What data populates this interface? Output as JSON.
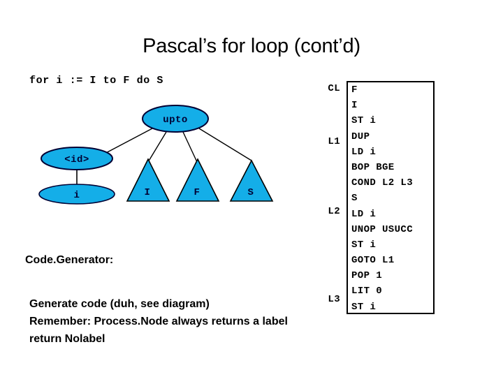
{
  "slide": {
    "title": "Pascal’s for loop (cont’d)",
    "source_line": "for i := I to F do S"
  },
  "colors": {
    "node_fill": "#14AEE8",
    "node_stroke": "#000033",
    "edge_stroke": "#000000",
    "text": "#000000",
    "background": "#FFFFFF"
  },
  "tree": {
    "root": {
      "label": "upto",
      "shape": "ellipse"
    },
    "id_node": {
      "label": "<id>",
      "shape": "ellipse"
    },
    "i_node": {
      "label": "i",
      "shape": "ellipse"
    },
    "subtrees": [
      {
        "label": "I",
        "shape": "triangle"
      },
      {
        "label": "F",
        "shape": "triangle"
      },
      {
        "label": "S",
        "shape": "triangle"
      }
    ]
  },
  "code": {
    "labels": [
      "CL",
      "",
      "",
      "L1",
      "",
      "",
      "",
      "L2",
      "",
      "",
      "",
      "",
      "L3",
      "",
      ""
    ],
    "lines": [
      "F",
      "I",
      "ST i",
      "DUP",
      "LD i",
      "BOP BGE",
      "COND L2 L3",
      "S",
      "LD i",
      "UNOP USUCC",
      "ST i",
      "GOTO L1",
      "POP 1",
      "LIT 0",
      "ST i"
    ]
  },
  "notes": {
    "heading": "Code.Generator:",
    "body": [
      "Generate code (duh, see diagram)",
      "Remember: Process.Node always returns a label",
      "return Nolabel"
    ]
  }
}
